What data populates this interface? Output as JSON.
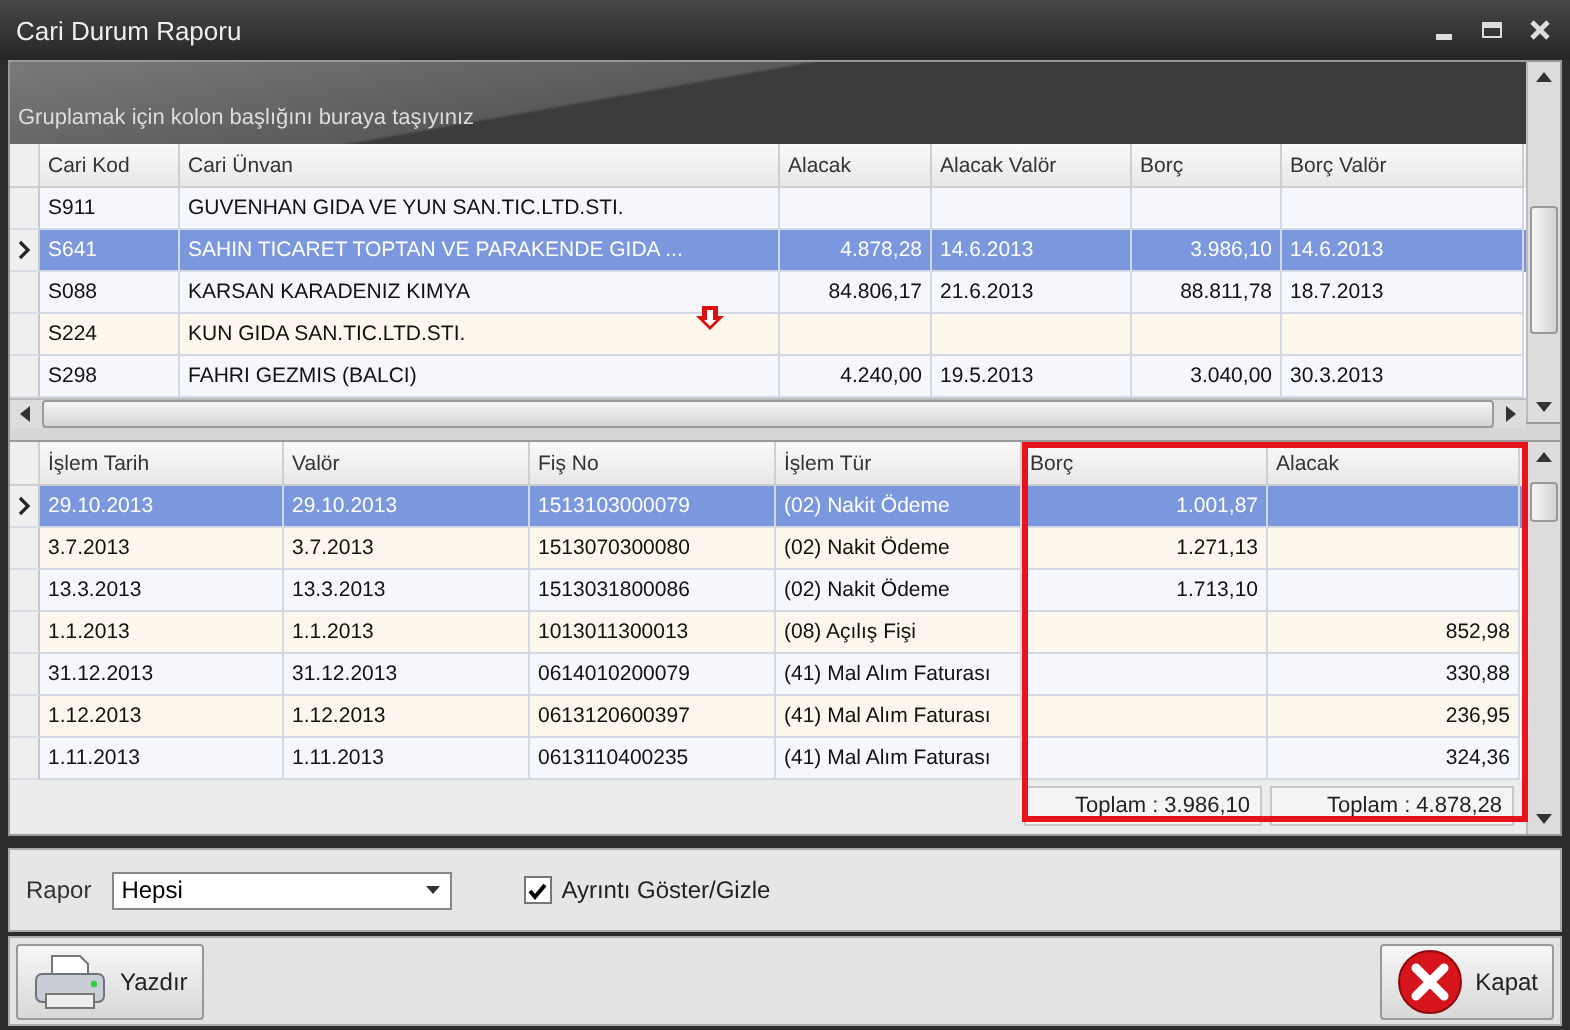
{
  "window": {
    "title": "Cari Durum Raporu"
  },
  "top_grid": {
    "group_hint": "Gruplamak için kolon başlığını buraya taşıyınız",
    "columns": [
      {
        "label": "Cari Kod",
        "kind": "text"
      },
      {
        "label": "Cari Ünvan",
        "kind": "text"
      },
      {
        "label": "Alacak",
        "kind": "number"
      },
      {
        "label": "Alacak Valör",
        "kind": "text"
      },
      {
        "label": "Borç",
        "kind": "number"
      },
      {
        "label": "Borç Valör",
        "kind": "text"
      }
    ],
    "rows": [
      {
        "selected": false,
        "cells": [
          "S911",
          "GUVENHAN GIDA VE YUN SAN.TIC.LTD.STI.",
          "",
          "",
          "",
          ""
        ]
      },
      {
        "selected": true,
        "cells": [
          "S641",
          "SAHIN TICARET TOPTAN VE PARAKENDE GIDA ...",
          "4.878,28",
          "14.6.2013",
          "3.986,10",
          "14.6.2013"
        ]
      },
      {
        "selected": false,
        "cells": [
          "S088",
          "KARSAN KARADENIZ KIMYA",
          "84.806,17",
          "21.6.2013",
          "88.811,78",
          "18.7.2013"
        ]
      },
      {
        "selected": false,
        "cells": [
          "S224",
          "KUN GIDA SAN.TIC.LTD.STI.",
          "",
          "",
          "",
          ""
        ]
      },
      {
        "selected": false,
        "cells": [
          "S298",
          "FAHRI GEZMIS (BALCI)",
          "4.240,00",
          "19.5.2013",
          "3.040,00",
          "30.3.2013"
        ]
      }
    ]
  },
  "bottom_grid": {
    "columns": [
      {
        "label": "İşlem Tarih",
        "kind": "text"
      },
      {
        "label": "Valör",
        "kind": "text"
      },
      {
        "label": "Fiş No",
        "kind": "text"
      },
      {
        "label": "İşlem Tür",
        "kind": "text"
      },
      {
        "label": "Borç",
        "kind": "number"
      },
      {
        "label": "Alacak",
        "kind": "number"
      }
    ],
    "rows": [
      {
        "selected": true,
        "cells": [
          "29.10.2013",
          "29.10.2013",
          "1513103000079",
          "(02) Nakit Ödeme",
          "1.001,87",
          ""
        ]
      },
      {
        "selected": false,
        "cells": [
          "3.7.2013",
          "3.7.2013",
          "1513070300080",
          "(02) Nakit Ödeme",
          "1.271,13",
          ""
        ]
      },
      {
        "selected": false,
        "cells": [
          "13.3.2013",
          "13.3.2013",
          "1513031800086",
          "(02) Nakit Ödeme",
          "1.713,10",
          ""
        ]
      },
      {
        "selected": false,
        "cells": [
          "1.1.2013",
          "1.1.2013",
          "1013011300013",
          "(08) Açılış Fişi",
          "",
          "852,98"
        ]
      },
      {
        "selected": false,
        "cells": [
          "31.12.2013",
          "31.12.2013",
          "0614010200079",
          "(41) Mal Alım Faturası",
          "",
          "330,88"
        ]
      },
      {
        "selected": false,
        "cells": [
          "1.12.2013",
          "1.12.2013",
          "0613120600397",
          "(41) Mal Alım Faturası",
          "",
          "236,95"
        ]
      },
      {
        "selected": false,
        "cells": [
          "1.11.2013",
          "1.11.2013",
          "0613110400235",
          "(41) Mal Alım Faturası",
          "",
          "324,36"
        ]
      }
    ],
    "footer": {
      "borc_total": "Toplam : 3.986,10",
      "alacak_total": "Toplam : 4.878,28"
    }
  },
  "options": {
    "report_label": "Rapor",
    "report_value": "Hepsi",
    "detail_checkbox": {
      "label": "Ayrıntı Göster/Gizle",
      "checked": true
    }
  },
  "buttons": [
    {
      "label": "Yazdır",
      "kind": "print"
    },
    {
      "label": "Kapat",
      "kind": "close"
    }
  ]
}
